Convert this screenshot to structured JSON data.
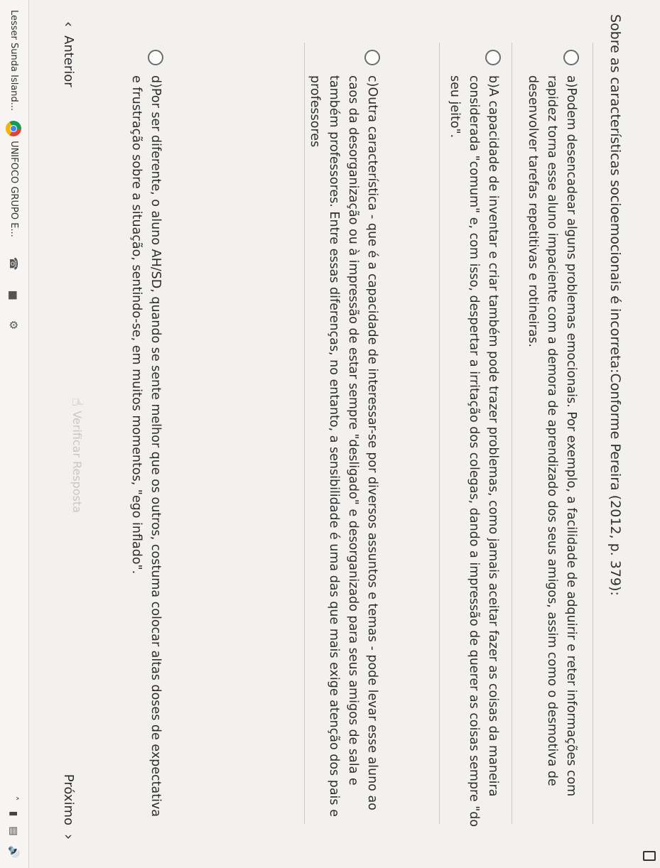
{
  "question": {
    "title": "Sobre as características socioemocionais é incorreta:Conforme Pereira (2012, p. 379):"
  },
  "options": [
    {
      "text": "a)Podem desencadear alguns problemas emocionais. Por exemplo, a facilidade de adquirir e reter informações com rapidez torna esse aluno impaciente com a demora de aprendizado dos seus amigos, assim como o desmotiva de desenvolver tarefas repetitivas e rotineiras."
    },
    {
      "text": "b)A capacidade de inventar e criar também pode trazer problemas, como jamais aceitar fazer as coisas da maneira considerada \"comum\" e, com isso, despertar a irritação dos colegas, dando a impressão de querer as coisas sempre \"do seu jeito\"."
    },
    {
      "text": "c)Outra característica - que é a capacidade de interessar-se por diversos assuntos e temas - pode levar esse aluno ao caos da desorganização ou à impressão de estar sempre \"desligado\" e desorganizado para seus amigos de sala e também professores. Entre essas diferenças, no entanto, a sensibilidade é uma das que mais exige atenção dos pais e professores"
    },
    {
      "text": "d)Por ser diferente, o aluno AH/SD, quando se sente melhor que os outros, costuma colocar altas doses de expectativa e frustração sobre a situação, sentindo-se, em muitos momentos, \"ego inflado\"."
    }
  ],
  "nav": {
    "prev_label": "Anterior",
    "next_label": "Próximo",
    "submit_label": "Verificar Resposta"
  },
  "taskbar": {
    "item1": "Lesser Sunda Island...",
    "item2": "UNIFOCO GRUPO E..."
  }
}
